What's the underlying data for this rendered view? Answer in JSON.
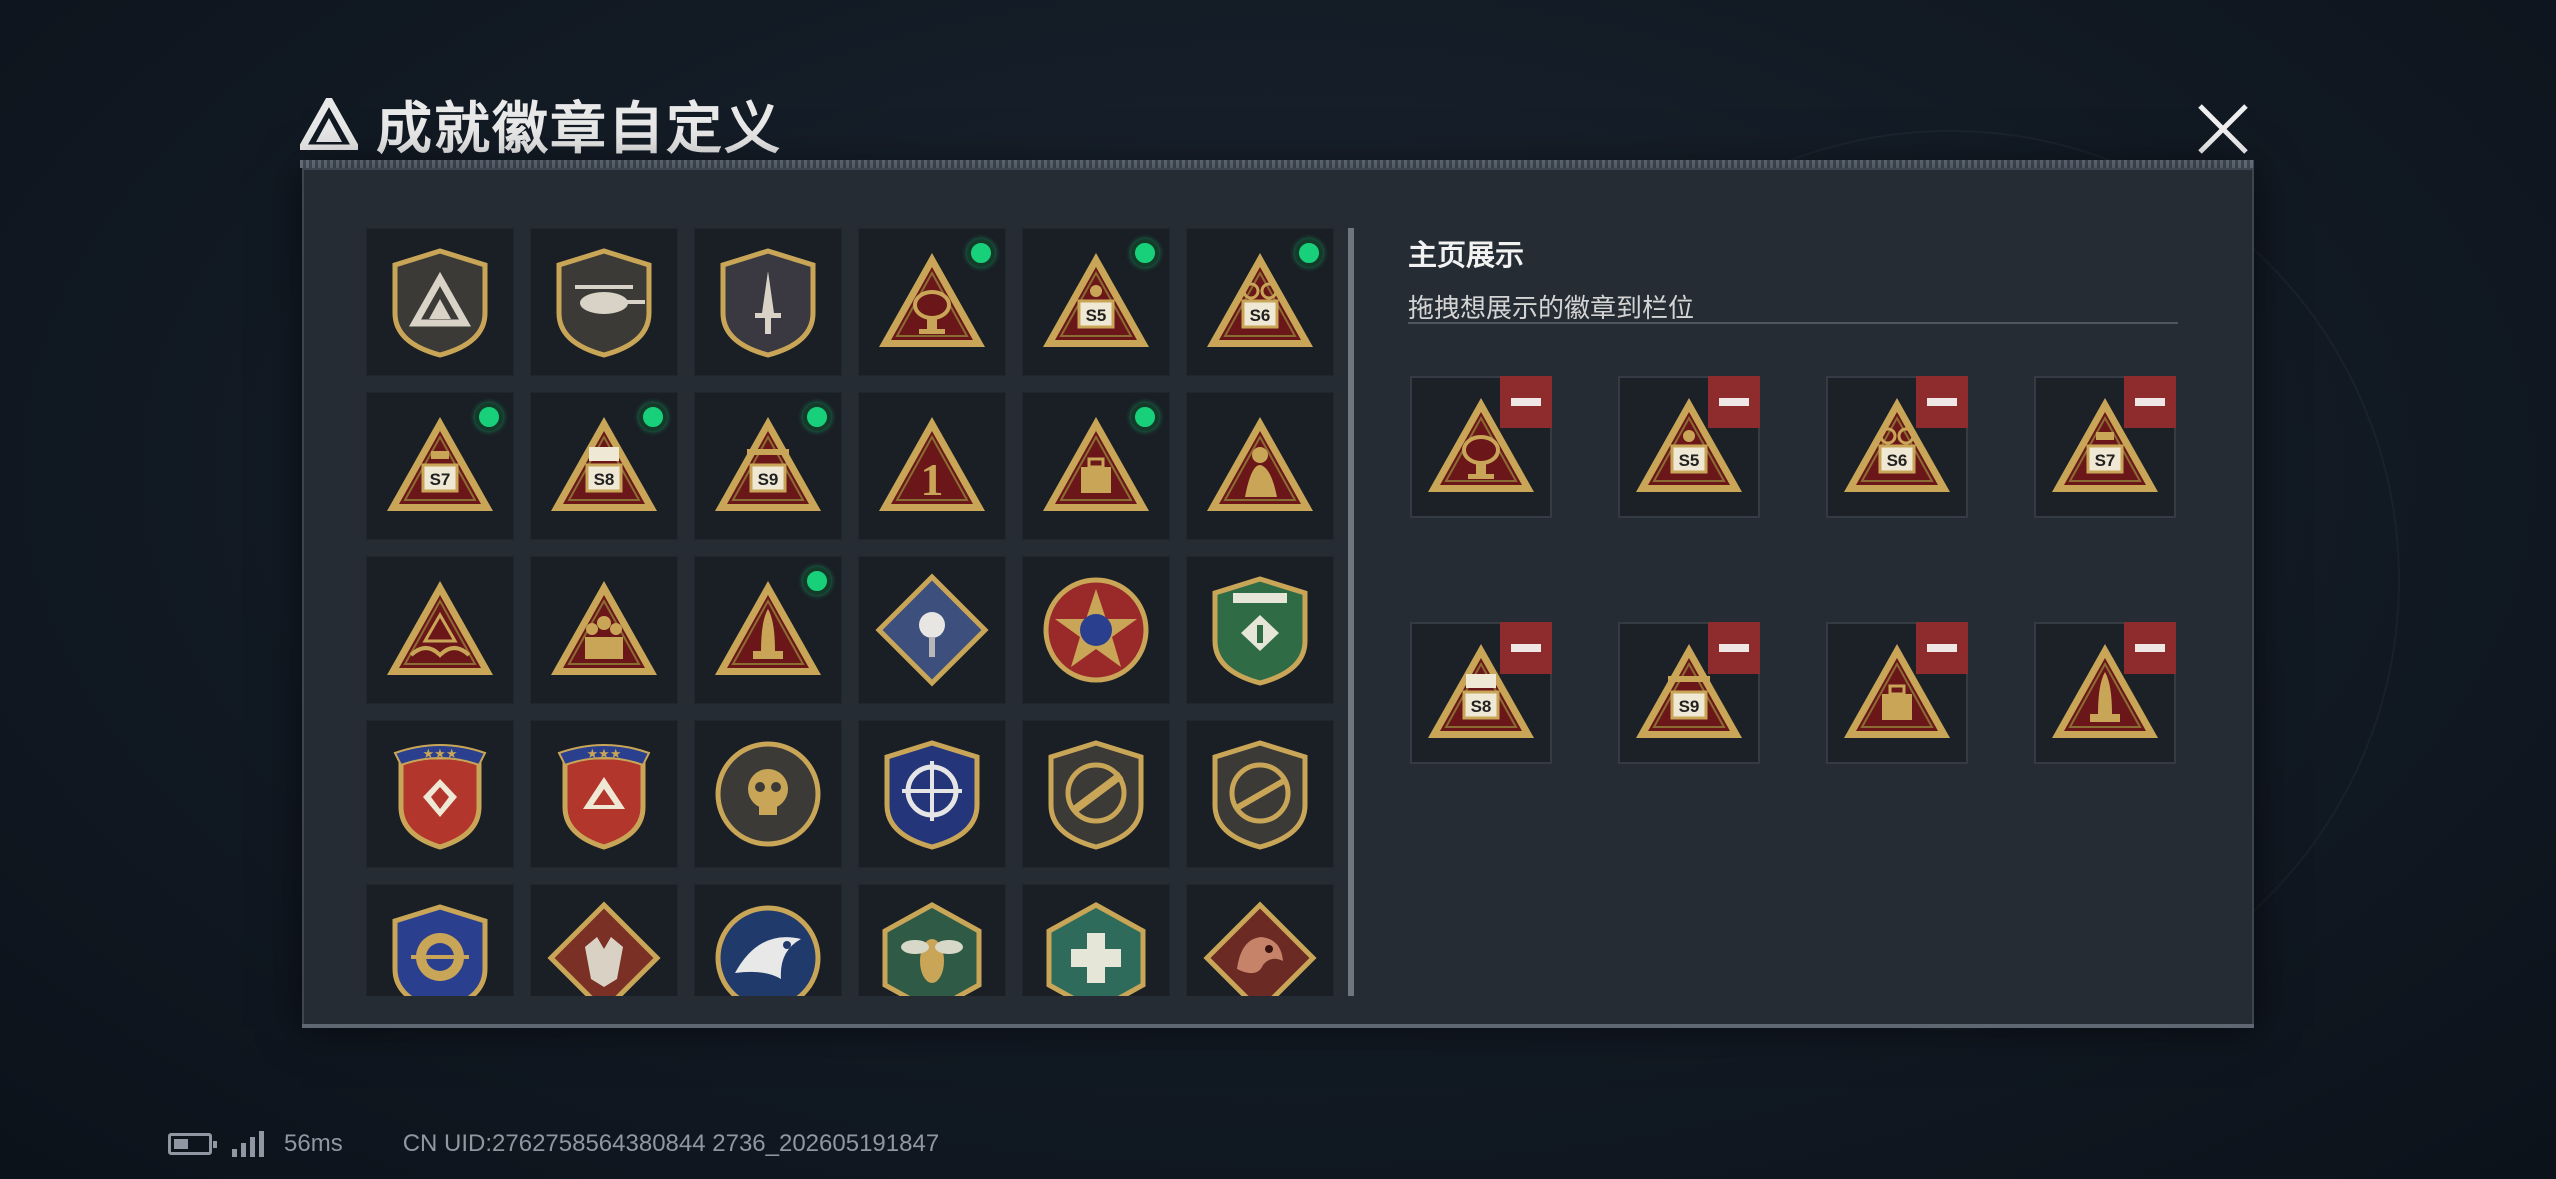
{
  "window": {
    "title": "成就徽章自定义",
    "close_icon": "close-x-icon"
  },
  "colors": {
    "panel_bg": "#262c34",
    "cell_bg": "#1a1f25",
    "new_dot": "#18d07a",
    "remove_button": "#8d2b2d",
    "gold": "#c9a657",
    "dark_red": "#6b1618"
  },
  "badge_grid": {
    "rows": [
      [
        {
          "icon": "shield-triangle-icon",
          "new": false
        },
        {
          "icon": "shield-helicopter-icon",
          "new": false
        },
        {
          "icon": "shield-dagger-icon",
          "new": false
        },
        {
          "icon": "triangle-satellite-dish-icon",
          "new": true
        },
        {
          "icon": "triangle-s5-icon",
          "new": true
        },
        {
          "icon": "triangle-s6-icon",
          "new": true
        }
      ],
      [
        {
          "icon": "triangle-s7-icon",
          "new": true
        },
        {
          "icon": "triangle-s8-icon",
          "new": true
        },
        {
          "icon": "triangle-s9-icon",
          "new": true
        },
        {
          "icon": "triangle-number-one-icon",
          "new": false
        },
        {
          "icon": "triangle-briefcase-icon",
          "new": true
        },
        {
          "icon": "triangle-soldier-icon",
          "new": false
        }
      ],
      [
        {
          "icon": "triangle-eagle-hands-icon",
          "new": false
        },
        {
          "icon": "triangle-squad-icon",
          "new": false
        },
        {
          "icon": "triangle-rocket-icon",
          "new": true
        },
        {
          "icon": "diamond-rose-icon",
          "new": false
        },
        {
          "icon": "round-star-icon",
          "new": false
        },
        {
          "icon": "green-shield-wings-icon",
          "new": false
        }
      ],
      [
        {
          "icon": "star-crest-red-icon",
          "new": false
        },
        {
          "icon": "star-crest-eagle-icon",
          "new": false
        },
        {
          "icon": "round-skull-icon",
          "new": false
        },
        {
          "icon": "blue-shield-crosshair-icon",
          "new": false
        },
        {
          "icon": "shield-rifle-icon",
          "new": false
        },
        {
          "icon": "shield-sniper-icon",
          "new": false
        }
      ],
      [
        {
          "icon": "blue-crest-crosshair-icon",
          "new": false
        },
        {
          "icon": "diamond-wolf-icon",
          "new": false
        },
        {
          "icon": "round-eagle-icon",
          "new": false
        },
        {
          "icon": "hexagon-hornet-icon",
          "new": false
        },
        {
          "icon": "hexagon-medic-icon",
          "new": false
        },
        {
          "icon": "diamond-dragon-icon",
          "new": false
        }
      ]
    ]
  },
  "showcase": {
    "heading": "主页展示",
    "subtitle": "拖拽想展示的徽章到栏位",
    "slots": [
      {
        "icon": "triangle-satellite-dish-icon"
      },
      {
        "icon": "triangle-s5-icon"
      },
      {
        "icon": "triangle-s6-icon"
      },
      {
        "icon": "triangle-s7-icon"
      },
      {
        "icon": "triangle-s8-icon"
      },
      {
        "icon": "triangle-s9-icon"
      },
      {
        "icon": "triangle-briefcase-icon"
      },
      {
        "icon": "triangle-rocket-icon"
      }
    ],
    "remove_icon": "minus-icon"
  },
  "status_bar": {
    "battery_icon": "battery-icon",
    "signal_icon": "signal-icon",
    "ping": "56ms",
    "uid": "CN UID:2762758564380844 2736_202605191847"
  }
}
